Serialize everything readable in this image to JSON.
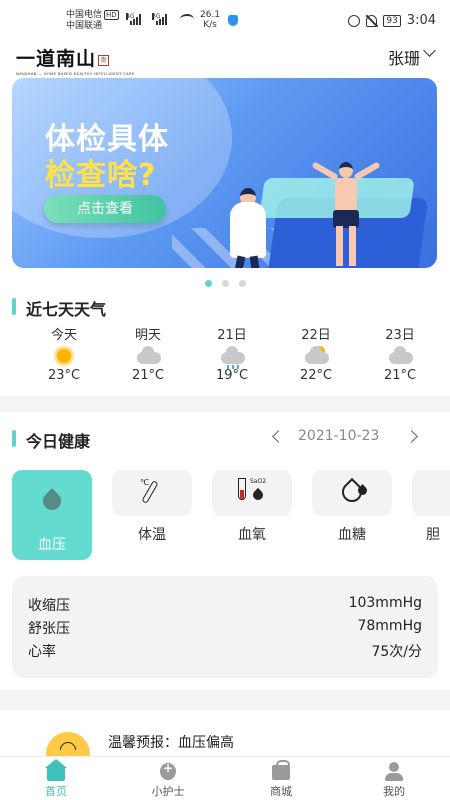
{
  "status_bar": {
    "carrier1": "中国电信",
    "carrier1_badge": "HD",
    "carrier2": "中国联通",
    "sig1_type": "4G",
    "sig2_type": "3G",
    "net_speed": "26.1",
    "net_unit": "K/s",
    "battery": "93",
    "time": "3:04"
  },
  "header": {
    "logo_text": "一道南山",
    "logo_seal": "南",
    "logo_subtitle": "NANSHAN — HOME BASED HEALTHY INTELLIGENT CARE",
    "user_name": "张珊"
  },
  "banner": {
    "title_line1": "体检具体",
    "title_line2": "检查啥?",
    "button_label": "点击查看",
    "slide_count": 3,
    "active_slide": 0
  },
  "weather": {
    "title": "近七天天气",
    "days": [
      {
        "day": "今天",
        "icon": "sun-icon",
        "temp": "23°C"
      },
      {
        "day": "明天",
        "icon": "cloud-icon",
        "temp": "21°C"
      },
      {
        "day": "21日",
        "icon": "rain-icon",
        "temp": "19°C"
      },
      {
        "day": "22日",
        "icon": "partly-cloudy-icon",
        "temp": "22°C"
      },
      {
        "day": "23日",
        "icon": "cloud-icon",
        "temp": "21°C"
      }
    ]
  },
  "health": {
    "title": "今日健康",
    "date": "2021-10-23",
    "metrics": [
      {
        "label": "血压",
        "icon": "blood-drop-icon",
        "active": true
      },
      {
        "label": "体温",
        "icon": "thermometer-icon",
        "active": false
      },
      {
        "label": "血氧",
        "icon": "test-tube-icon",
        "active": false,
        "icon_text": "SaO2"
      },
      {
        "label": "血糖",
        "icon": "glucose-drop-icon",
        "active": false
      },
      {
        "label": "胆",
        "icon": "partial-card-icon",
        "active": false
      }
    ],
    "vitals": [
      {
        "label": "收缩压",
        "value": "103mmHg"
      },
      {
        "label": "舒张压",
        "value": "78mmHg"
      },
      {
        "label": "心率",
        "value": "75次/分"
      }
    ]
  },
  "alert": {
    "text": "温馨预报：血压偏高"
  },
  "nav": {
    "items": [
      {
        "label": "首页",
        "icon": "home-icon",
        "active": true
      },
      {
        "label": "小护士",
        "icon": "nurse-icon",
        "active": false
      },
      {
        "label": "商城",
        "icon": "shopping-bag-icon",
        "active": false
      },
      {
        "label": "我的",
        "icon": "profile-icon",
        "active": false
      }
    ]
  },
  "colors": {
    "accent": "#5fd6cd",
    "banner_blue": "#3a6fe0",
    "highlight_yellow": "#ffe24a"
  }
}
